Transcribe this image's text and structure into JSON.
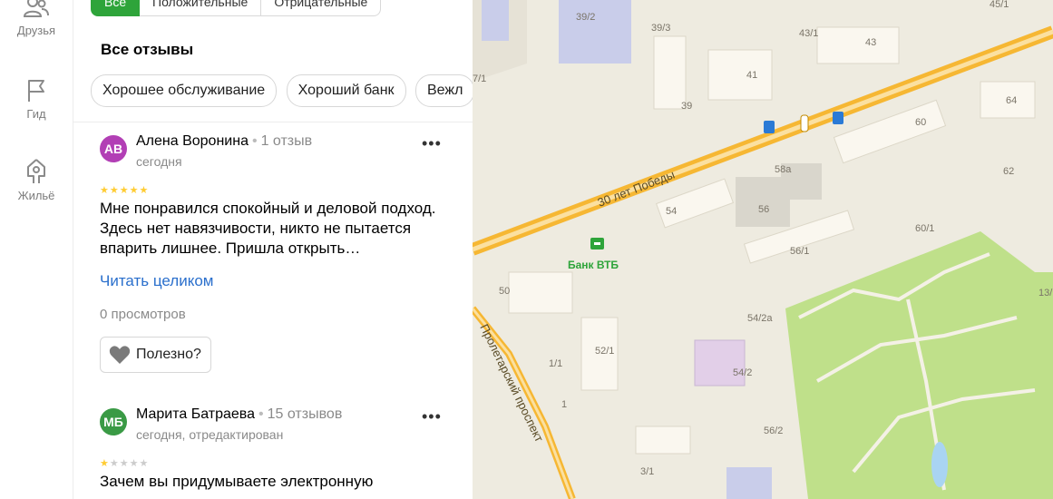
{
  "rail": {
    "friends_label": "Друзья",
    "guide_label": "Гид",
    "housing_label": "Жильё"
  },
  "tabs": [
    "Все",
    "Положительные",
    "Отрицательные"
  ],
  "reviews_title": "Все отзывы",
  "chips": [
    "Хорошее обслуживание",
    "Хороший банк",
    "Вежл"
  ],
  "reviews": [
    {
      "initials": "АВ",
      "avatar_color": "#b23fb5",
      "name": "Алена Воронина",
      "count": "1 отзыв",
      "date": "сегодня",
      "rating": 5,
      "text": "Мне понравился спокойный и деловой подход. Здесь нет навязчивости, никто не пытается впарить лишнее. Пришла открыть…",
      "read_more": "Читать целиком",
      "views": "0 просмотров",
      "useful": "Полезно?"
    },
    {
      "initials": "МБ",
      "avatar_color": "#3a9a45",
      "name": "Марита Батраева",
      "count": "15 отзывов",
      "date": "сегодня, отредактирован",
      "rating": 1,
      "text": "Зачем вы придумываете электронную"
    }
  ],
  "map": {
    "street_main": "30 лет Победы",
    "street_side": "Пролетарский проспект",
    "poi": "Банк ВТБ",
    "poi_color": "#2ea43a",
    "road_color": "#f6b733",
    "park_color": "#bfe08a",
    "houses": [
      "39/2",
      "39/3",
      "45/1",
      "43/1",
      "43",
      "41",
      "39",
      "64",
      "60",
      "7/1",
      "58а",
      "62",
      "56",
      "54",
      "60/1",
      "56/1",
      "50",
      "54/2а",
      "52/1",
      "1/1",
      "54/2",
      "1",
      "56/2",
      "3/1",
      "13/"
    ]
  }
}
